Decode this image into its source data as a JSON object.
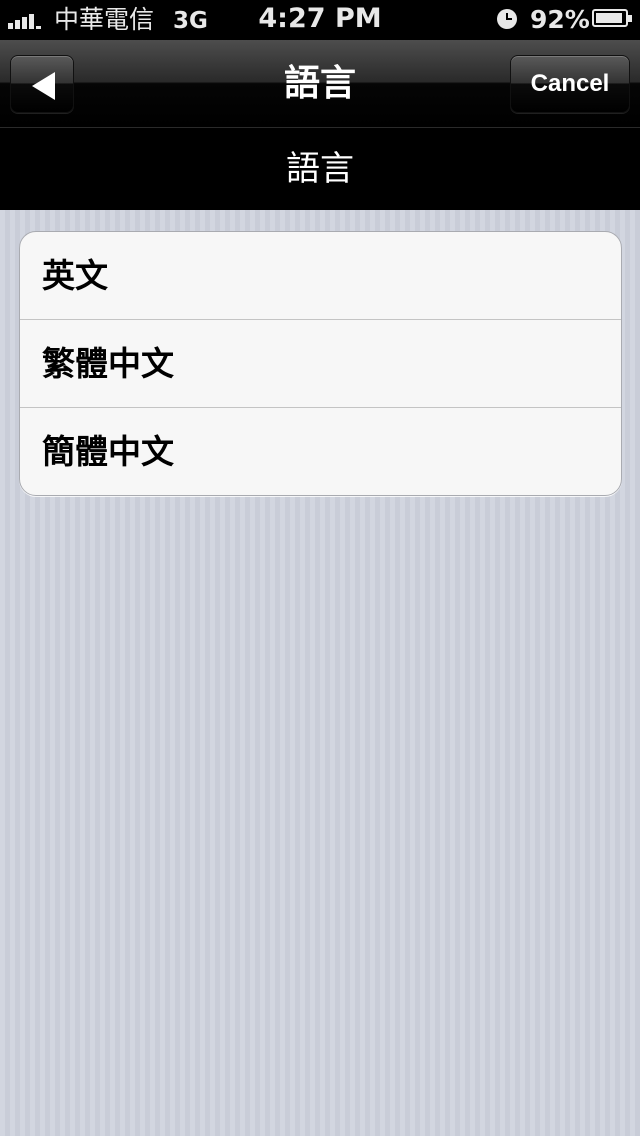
{
  "status_bar": {
    "carrier": "中華電信",
    "network": "3G",
    "time": "4:27 PM",
    "battery_percent": "92%",
    "battery_level": 0.92,
    "icons": [
      "signal-bars-icon",
      "clock-icon",
      "battery-icon"
    ]
  },
  "nav_bar": {
    "title": "語言",
    "back_icon": "back-arrow-icon",
    "cancel_label": "Cancel"
  },
  "sub_header": {
    "title": "語言"
  },
  "language_list": {
    "items": [
      {
        "label": "英文"
      },
      {
        "label": "繁體中文"
      },
      {
        "label": "簡體中文"
      }
    ]
  },
  "colors": {
    "bar_background": "#000000",
    "list_background": "#f7f7f7",
    "page_background": "#cfd3dd",
    "text_light": "#ffffff",
    "text_dark": "#000000"
  }
}
